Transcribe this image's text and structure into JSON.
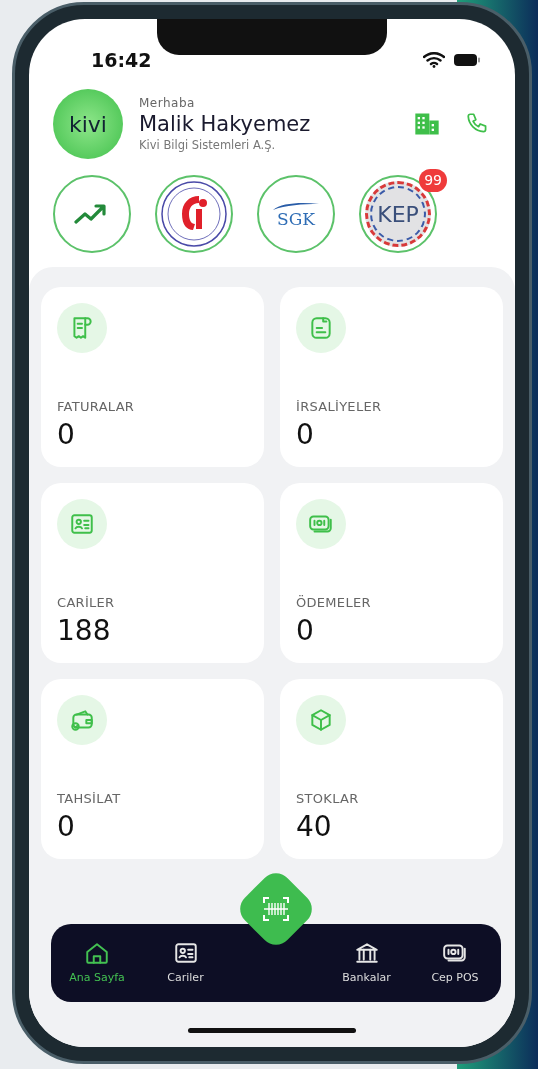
{
  "status_bar": {
    "time": "16:42"
  },
  "header": {
    "logo_text": "kivi",
    "greeting": "Merhaba",
    "name": "Malik Hakyemez",
    "company": "Kivi Bilgi Sistemleri A.Ş."
  },
  "shortcuts": [
    {
      "kind": "chart"
    },
    {
      "kind": "gib"
    },
    {
      "kind": "sgk",
      "logo_text": "SGK"
    },
    {
      "kind": "kep",
      "logo_text": "KEP",
      "badge": "99"
    }
  ],
  "cards": [
    {
      "label": "FATURALAR",
      "value": "0"
    },
    {
      "label": "İRSALİYELER",
      "value": "0"
    },
    {
      "label": "CARİLER",
      "value": "188"
    },
    {
      "label": "ÖDEMELER",
      "value": "0"
    },
    {
      "label": "TAHSİLAT",
      "value": "0"
    },
    {
      "label": "STOKLAR",
      "value": "40"
    }
  ],
  "bottom_nav": [
    {
      "label": "Ana Sayfa",
      "selected": true
    },
    {
      "label": "Cariler",
      "selected": false
    },
    {
      "label": "Bankalar",
      "selected": false
    },
    {
      "label": "Cep POS",
      "selected": false
    }
  ]
}
